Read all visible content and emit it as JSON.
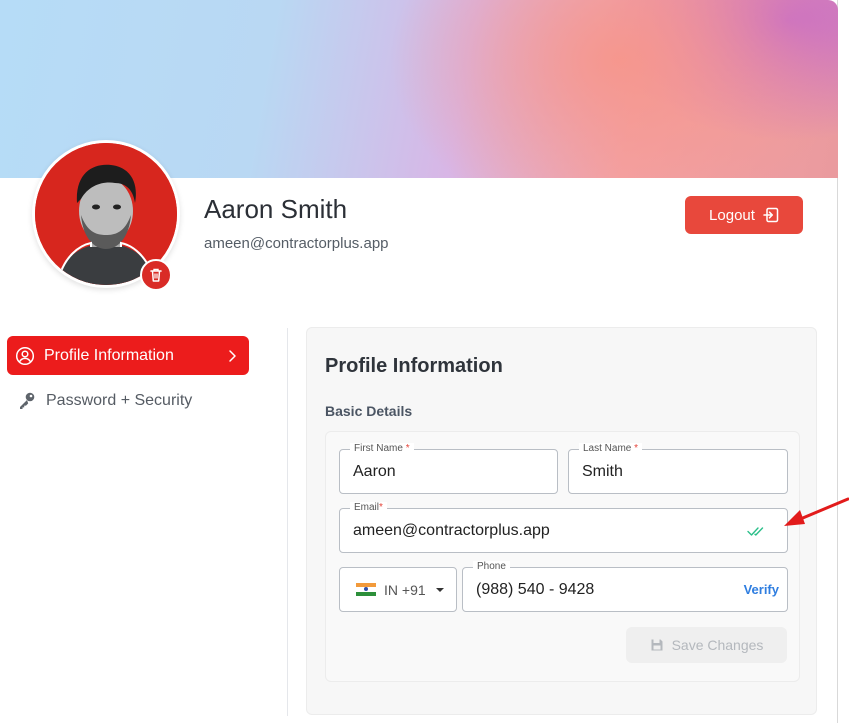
{
  "user": {
    "name": "Aaron Smith",
    "email": "ameen@contractorplus.app"
  },
  "header": {
    "logout_label": "Logout"
  },
  "sidebar": {
    "items": [
      {
        "label": "Profile Information",
        "active": true,
        "icon": "user-circle-icon"
      },
      {
        "label": "Password + Security",
        "active": false,
        "icon": "key-icon"
      }
    ]
  },
  "card": {
    "title": "Profile Information",
    "section": "Basic Details"
  },
  "form": {
    "first_name": {
      "label": "First Name",
      "required_mark": "*",
      "value": "Aaron"
    },
    "last_name": {
      "label": "Last Name",
      "required_mark": "*",
      "value": "Smith"
    },
    "email": {
      "label": "Email",
      "required_mark": "*",
      "value": "ameen@contractorplus.app",
      "status_icon": "double-check-icon"
    },
    "country": {
      "code": "IN +91",
      "flag": "india-flag-icon"
    },
    "phone": {
      "label": "Phone",
      "value": "(988) 540 - 9428",
      "verify_label": "Verify"
    },
    "save_label": "Save Changes"
  },
  "colors": {
    "accent": "#ec1c1c",
    "logout": "#e8483c",
    "verify": "#2f7ee0",
    "verified_check": "#2bbf8a",
    "arrow": "#e21b1b"
  }
}
